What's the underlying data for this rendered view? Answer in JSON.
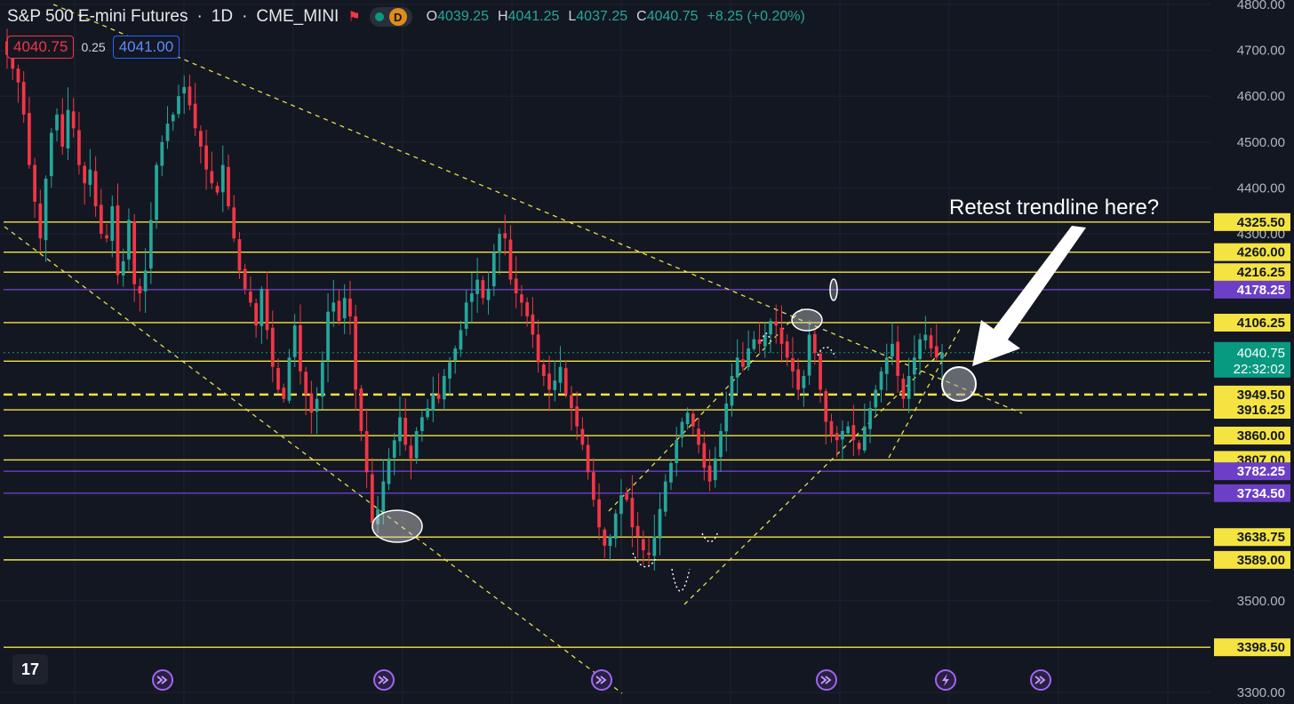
{
  "header": {
    "symbol": "S&P 500 E-mini Futures",
    "sep1": "·",
    "interval": "1D",
    "sep2": "·",
    "exchange": "CME_MINI",
    "flag_icon": "flag-icon",
    "data_badge": "D"
  },
  "ohlc": {
    "o_label": "O",
    "o": "4039.25",
    "h_label": "H",
    "h": "4041.25",
    "l_label": "L",
    "l": "4037.25",
    "c_label": "C",
    "c": "4040.75",
    "change": "+8.25 (+0.20%)"
  },
  "trade": {
    "sell_price": "4040.75",
    "spread": "0.25",
    "buy_price": "4041.00"
  },
  "colors": {
    "background": "#131722",
    "up": "#26a69a",
    "down": "#f23645",
    "level_yellow": "#f5e342",
    "level_purple": "#6c3fc6",
    "last_price": "#089981"
  },
  "annotation": {
    "text": "Retest trendline here?"
  },
  "logo_text": "17",
  "chart_data": {
    "type": "candlestick",
    "symbol": "S&P 500 E-mini Futures",
    "interval": "1D",
    "y_axis": {
      "ylim": [
        3300,
        4800
      ],
      "tick_labels": [
        "4800.00",
        "4700.00",
        "4600.00",
        "4500.00",
        "4400.00",
        "4300.00",
        "3500.00",
        "3300.00"
      ],
      "tick_values": [
        4800,
        4700,
        4600,
        4500,
        4400,
        4300,
        3500,
        3300
      ]
    },
    "last_price": {
      "value": 4040.75,
      "label": "4040.75",
      "countdown": "22:32:02"
    },
    "horizontal_levels": [
      {
        "label": "4325.50",
        "value": 4325.5,
        "color": "yellow"
      },
      {
        "label": "4260.00",
        "value": 4260.0,
        "color": "yellow"
      },
      {
        "label": "4216.25",
        "value": 4216.25,
        "color": "yellow"
      },
      {
        "label": "4178.25",
        "value": 4178.25,
        "color": "purple"
      },
      {
        "label": "4106.25",
        "value": 4106.25,
        "color": "yellow"
      },
      {
        "label": "4022.25",
        "value": 4022.25,
        "color": "yellow"
      },
      {
        "label": "3949.50",
        "value": 3949.5,
        "color": "yellow",
        "dashed": true
      },
      {
        "label": "3916.25",
        "value": 3916.25,
        "color": "yellow"
      },
      {
        "label": "3860.00",
        "value": 3860.0,
        "color": "yellow"
      },
      {
        "label": "3807.00",
        "value": 3807.0,
        "color": "yellow"
      },
      {
        "label": "3782.25",
        "value": 3782.25,
        "color": "purple"
      },
      {
        "label": "3734.50",
        "value": 3734.5,
        "color": "purple"
      },
      {
        "label": "3638.75",
        "value": 3638.75,
        "color": "yellow"
      },
      {
        "label": "3589.00",
        "value": 3589.0,
        "color": "yellow"
      },
      {
        "label": "3398.50",
        "value": 3398.5,
        "color": "yellow"
      }
    ],
    "closes": [
      4690,
      4660,
      4630,
      4560,
      4450,
      4370,
      4290,
      4420,
      4520,
      4560,
      4490,
      4570,
      4530,
      4450,
      4410,
      4440,
      4360,
      4300,
      4290,
      4360,
      4210,
      4240,
      4330,
      4190,
      4170,
      4220,
      4330,
      4450,
      4500,
      4540,
      4560,
      4600,
      4620,
      4580,
      4530,
      4490,
      4440,
      4410,
      4390,
      4450,
      4360,
      4290,
      4220,
      4180,
      4150,
      4100,
      4180,
      4090,
      4010,
      3960,
      3940,
      4030,
      4100,
      4000,
      3950,
      3910,
      3940,
      4020,
      4130,
      4150,
      4110,
      4160,
      4120,
      3960,
      3870,
      3780,
      3670,
      3700,
      3760,
      3810,
      3850,
      3900,
      3840,
      3810,
      3870,
      3900,
      3920,
      3950,
      3940,
      3990,
      4020,
      4050,
      4090,
      4150,
      4170,
      4200,
      4160,
      4180,
      4260,
      4300,
      4290,
      4200,
      4170,
      4150,
      4120,
      4080,
      4020,
      3990,
      3960,
      3980,
      4010,
      3950,
      3920,
      3880,
      3840,
      3780,
      3720,
      3660,
      3620,
      3640,
      3690,
      3730,
      3720,
      3660,
      3640,
      3610,
      3600,
      3640,
      3700,
      3760,
      3800,
      3850,
      3890,
      3910,
      3880,
      3840,
      3790,
      3760,
      3810,
      3870,
      3930,
      3990,
      4030,
      4010,
      4050,
      4070,
      4060,
      4080,
      4110,
      4100,
      4060,
      4030,
      4000,
      3960,
      3990,
      4080,
      4040,
      3960,
      3890,
      3860,
      3850,
      3870,
      3880,
      3850,
      3830,
      3880,
      3920,
      3960,
      4000,
      4030,
      4060,
      3990,
      3940,
      3990,
      4030,
      4070,
      4080,
      4050,
      4030,
      4040.75
    ]
  },
  "footer_markers": [
    {
      "icon": "forward-circle-icon"
    },
    {
      "icon": "forward-circle-icon"
    },
    {
      "icon": "forward-circle-icon"
    },
    {
      "icon": "forward-circle-icon"
    },
    {
      "icon": "lightning-circle-icon"
    },
    {
      "icon": "forward-circle-icon"
    }
  ]
}
